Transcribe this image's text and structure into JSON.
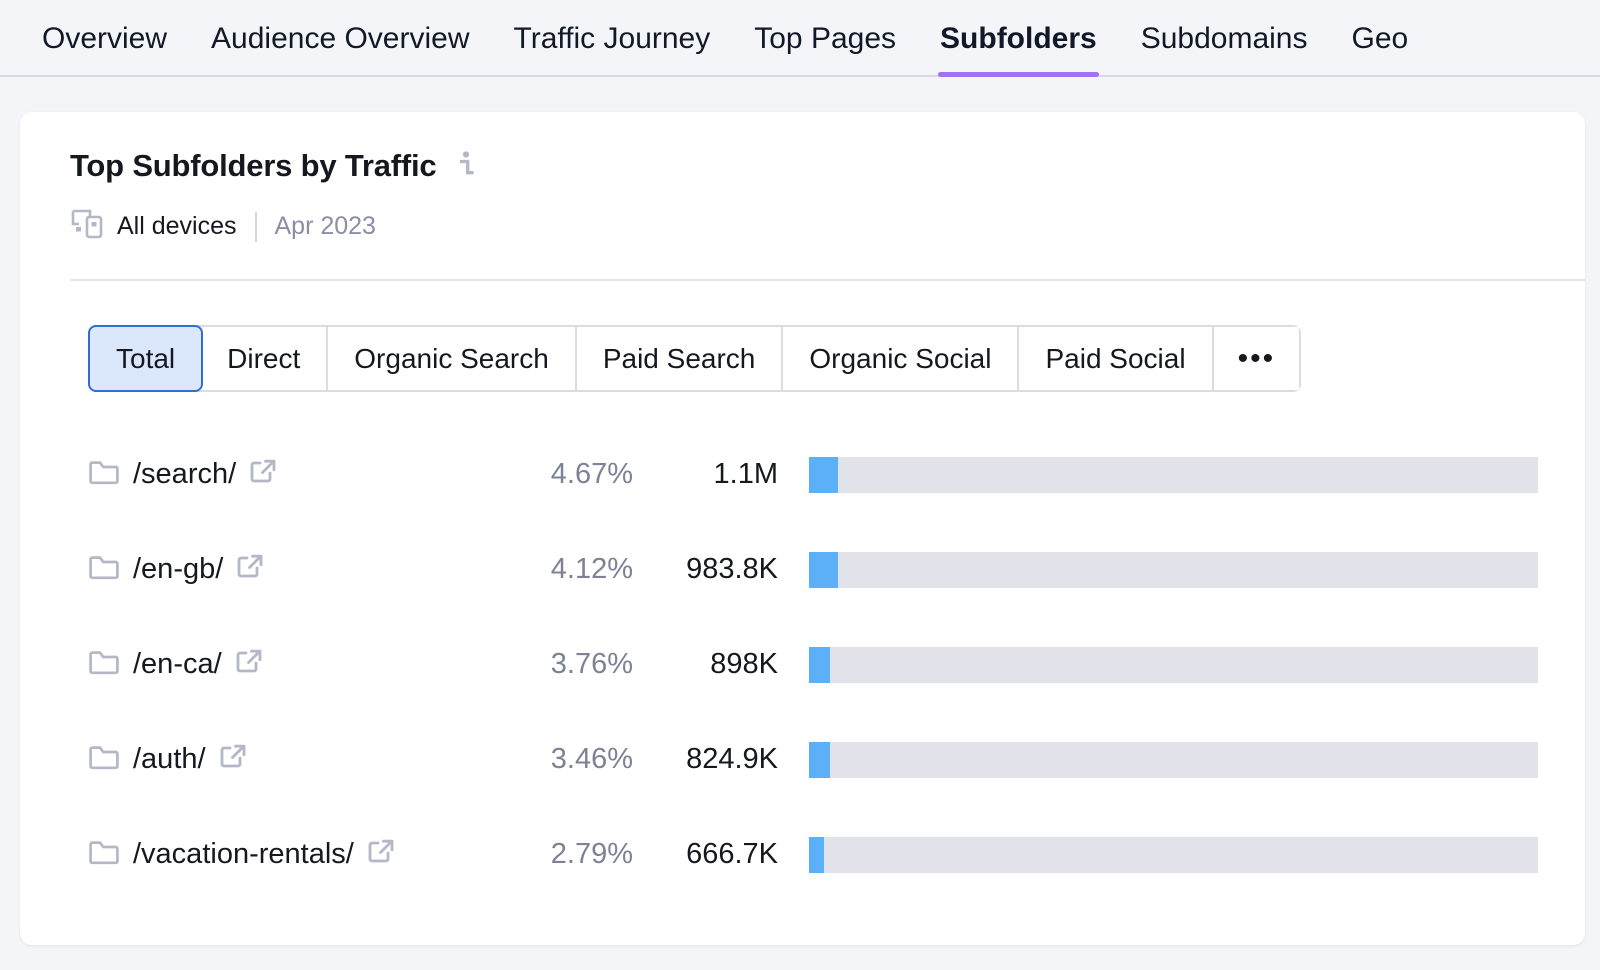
{
  "nav": {
    "tabs": [
      {
        "label": "Overview",
        "active": false
      },
      {
        "label": "Audience Overview",
        "active": false
      },
      {
        "label": "Traffic Journey",
        "active": false
      },
      {
        "label": "Top Pages",
        "active": false
      },
      {
        "label": "Subfolders",
        "active": true
      },
      {
        "label": "Subdomains",
        "active": false
      },
      {
        "label": "Geo",
        "active": false
      }
    ],
    "active_tab": "Subfolders",
    "active_underline_color": "#a371f7"
  },
  "card": {
    "title": "Top Subfolders by Traffic",
    "info_icon": "info-icon",
    "devices_icon": "devices-icon",
    "devices_label": "All devices",
    "period": "Apr 2023"
  },
  "filters": {
    "options": [
      "Total",
      "Direct",
      "Organic Search",
      "Paid Search",
      "Organic Social",
      "Paid Social"
    ],
    "more_label": "•••",
    "selected": "Total",
    "selected_bg": "#dbe8fb",
    "selected_border": "#2f6fd0"
  },
  "chart_data": {
    "type": "bar",
    "title": "Top Subfolders by Traffic",
    "xlabel": "",
    "ylabel": "",
    "orientation": "horizontal",
    "grid": false,
    "legend": false,
    "bar_color": "#5cb0f7",
    "track_color": "#e1e2ea",
    "max_value": 33000000,
    "categories": [
      "/search/",
      "/en-gb/",
      "/en-ca/",
      "/auth/",
      "/vacation-rentals/"
    ],
    "values": [
      1100000,
      983800,
      898000,
      824900,
      666700
    ],
    "value_labels": [
      "1.1M",
      "983.8K",
      "898K",
      "824.9K",
      "666.7K"
    ],
    "percent_labels": [
      "4.67%",
      "4.12%",
      "3.76%",
      "3.46%",
      "2.79%"
    ],
    "percents": [
      4.67,
      4.12,
      3.76,
      3.46,
      2.79
    ],
    "bar_fill_ratio": [
      0.0394,
      0.0394,
      0.0292,
      0.0292,
      0.0203
    ]
  },
  "rows": [
    {
      "folder_icon": "folder-icon",
      "path": "/search/",
      "ext_icon": "external-link-icon",
      "pct": "4.67%",
      "value": "1.1M",
      "fill": "3.94%"
    },
    {
      "folder_icon": "folder-icon",
      "path": "/en-gb/",
      "ext_icon": "external-link-icon",
      "pct": "4.12%",
      "value": "983.8K",
      "fill": "3.94%"
    },
    {
      "folder_icon": "folder-icon",
      "path": "/en-ca/",
      "ext_icon": "external-link-icon",
      "pct": "3.76%",
      "value": "898K",
      "fill": "2.92%"
    },
    {
      "folder_icon": "folder-icon",
      "path": "/auth/",
      "ext_icon": "external-link-icon",
      "pct": "3.46%",
      "value": "824.9K",
      "fill": "2.92%"
    },
    {
      "folder_icon": "folder-icon",
      "path": "/vacation-rentals/",
      "ext_icon": "external-link-icon",
      "pct": "2.79%",
      "value": "666.7K",
      "fill": "2.03%"
    }
  ]
}
